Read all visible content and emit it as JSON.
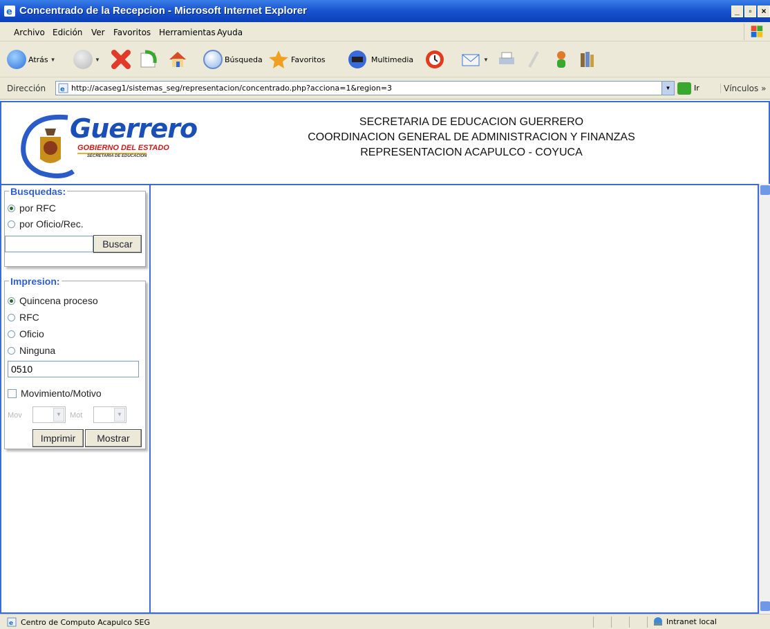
{
  "window": {
    "title": "Concentrado de la Recepcion - Microsoft Internet Explorer"
  },
  "menu": [
    "Archivo",
    "Edición",
    "Ver",
    "Favoritos",
    "Herramientas",
    "Ayuda"
  ],
  "toolbar": {
    "back": "Atrás",
    "search": "Búsqueda",
    "favorites": "Favoritos",
    "media": "Multimedia"
  },
  "address": {
    "label": "Dirección",
    "url": "http://acaseg1/sistemas_seg/representacion/concentrado.php?acciona=1&region=3",
    "go": "Ir",
    "links": "Vínculos"
  },
  "logo": {
    "name": "Guerrero",
    "subtitle": "GOBIERNO DEL ESTADO",
    "department": "SECRETARIA DE EDUCACION"
  },
  "header": {
    "line1": "SECRETARIA DE EDUCACION GUERRERO",
    "line2": "COORDINACION GENERAL DE ADMINISTRACION Y FINANZAS",
    "line3": "REPRESENTACION ACAPULCO - COYUCA"
  },
  "search": {
    "legend": "Busquedas:",
    "options": [
      "por RFC",
      "por Oficio/Rec."
    ],
    "selected": 0,
    "value": "",
    "button": "Buscar"
  },
  "print": {
    "legend": "Impresion:",
    "options": [
      "Quincena proceso",
      "RFC",
      "Oficio",
      "Ninguna"
    ],
    "selected": 0,
    "value": "0510",
    "checkbox": "Movimiento/Motivo",
    "mov_label": "Mov",
    "mot_label": "Mot",
    "print_button": "Imprimir",
    "show_button": "Mostrar"
  },
  "status": {
    "message": "Centro de Computo Acapulco  SEG",
    "zone": "Intranet local"
  }
}
